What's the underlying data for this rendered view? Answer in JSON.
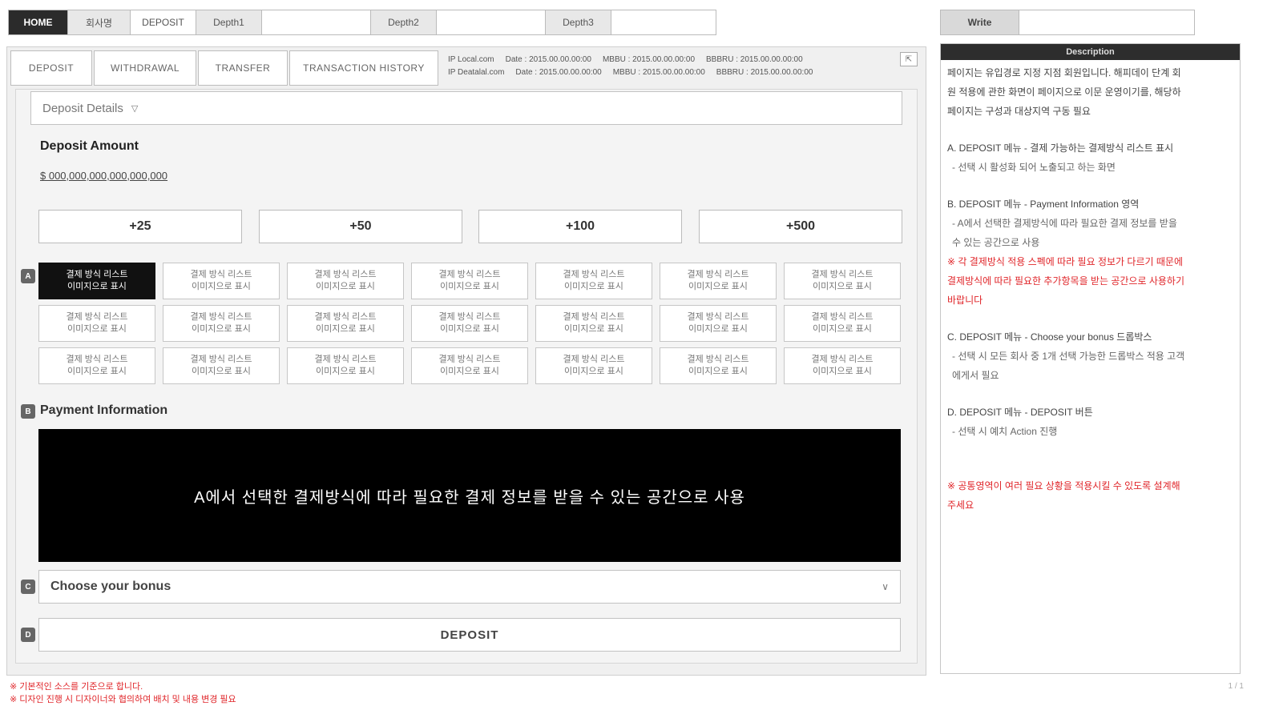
{
  "topbar": {
    "home": "HOME",
    "cells": [
      "회사명",
      "DEPOSIT",
      "Depth1",
      "",
      "Depth2",
      "",
      "Depth3",
      ""
    ]
  },
  "topright": {
    "label": "Write",
    "value": ""
  },
  "tabs": [
    "DEPOSIT",
    "WITHDRAWAL",
    "TRANSFER",
    "TRANSACTION HISTORY"
  ],
  "ip_info": [
    [
      "IP Local.com",
      "Date : 2015.00.00.00:00",
      "MBBU : 2015.00.00.00:00",
      "BBBRU : 2015.00.00.00:00"
    ],
    [
      "IP Deatalal.com",
      "Date : 2015.00.00.00:00",
      "MBBU : 2015.00.00.00:00",
      "BBBRU : 2015.00.00.00:00"
    ]
  ],
  "expand_label": "⇱",
  "details_label": "Deposit Details",
  "deposit": {
    "title": "Deposit Amount",
    "amount": "$ 000,000,000,000,000,000"
  },
  "quick_amounts": [
    "+25",
    "+50",
    "+100",
    "+500"
  ],
  "method_label": "결제 방식 리스트\n이미지으로 표시",
  "method_count": 21,
  "payment_title": "Payment Information",
  "payment_placeholder": "A에서 선택한 결제방식에 따라 필요한 결제 정보를 받을 수 있는 공간으로 사용",
  "bonus_placeholder": "Choose your bonus",
  "deposit_button": "DEPOSIT",
  "description": {
    "header": "Description",
    "lines": [
      {
        "t": "페이지는 유입경로 지정 지점 회원입니다. 해피데이 단계 회",
        "c": ""
      },
      {
        "t": "원 적용에 관한 화면이 페이지으로 이문 운영이기를, 해당하",
        "c": ""
      },
      {
        "t": "페이지는 구성과 대상지역 구동 필요",
        "c": ""
      },
      {
        "t": "",
        "c": "gap"
      },
      {
        "t": "A. DEPOSIT 메뉴 - 결제 가능하는 결제방식 리스트 표시",
        "c": ""
      },
      {
        "t": "- 선택 시 활성화 되어 노출되고 하는 화면",
        "c": "sub"
      },
      {
        "t": "",
        "c": "gap"
      },
      {
        "t": "B. DEPOSIT 메뉴 - Payment Information 영역",
        "c": ""
      },
      {
        "t": "- A에서 선택한 결제방식에 따라 필요한 결제 정보를 받을",
        "c": "sub"
      },
      {
        "t": "수 있는 공간으로 사용",
        "c": "sub"
      },
      {
        "t": "※ 각 결제방식 적용 스펙에 따라 필요 정보가 다르기 때문에",
        "c": "red"
      },
      {
        "t": "결제방식에 따라 필요한 추가항목을 받는 공간으로 사용하기",
        "c": "red"
      },
      {
        "t": "바랍니다",
        "c": "red"
      },
      {
        "t": "",
        "c": "gap"
      },
      {
        "t": "C. DEPOSIT 메뉴 - Choose your bonus 드롭박스",
        "c": ""
      },
      {
        "t": "- 선택 시 모든 회사 중 1개 선택 가능한 드롭박스 적용 고객",
        "c": "sub"
      },
      {
        "t": "에게서 필요",
        "c": "sub"
      },
      {
        "t": "",
        "c": "gap"
      },
      {
        "t": "D. DEPOSIT 메뉴 - DEPOSIT 버튼",
        "c": ""
      },
      {
        "t": "- 선택 시 예치 Action 진행",
        "c": "sub"
      },
      {
        "t": "",
        "c": "gap"
      },
      {
        "t": "",
        "c": "gap"
      },
      {
        "t": "※ 공통영역이 여러 필요 상황을 적용시킬 수 있도록 설계해",
        "c": "red"
      },
      {
        "t": "주세요",
        "c": "red"
      }
    ]
  },
  "footnotes": [
    "※ 기본적인 소스를 기준으로 합니다.",
    "※ 디자인 진행 시 디자이너와 협의하여 배치 및 내용 변경 필요"
  ],
  "page_number": "1 / 1"
}
